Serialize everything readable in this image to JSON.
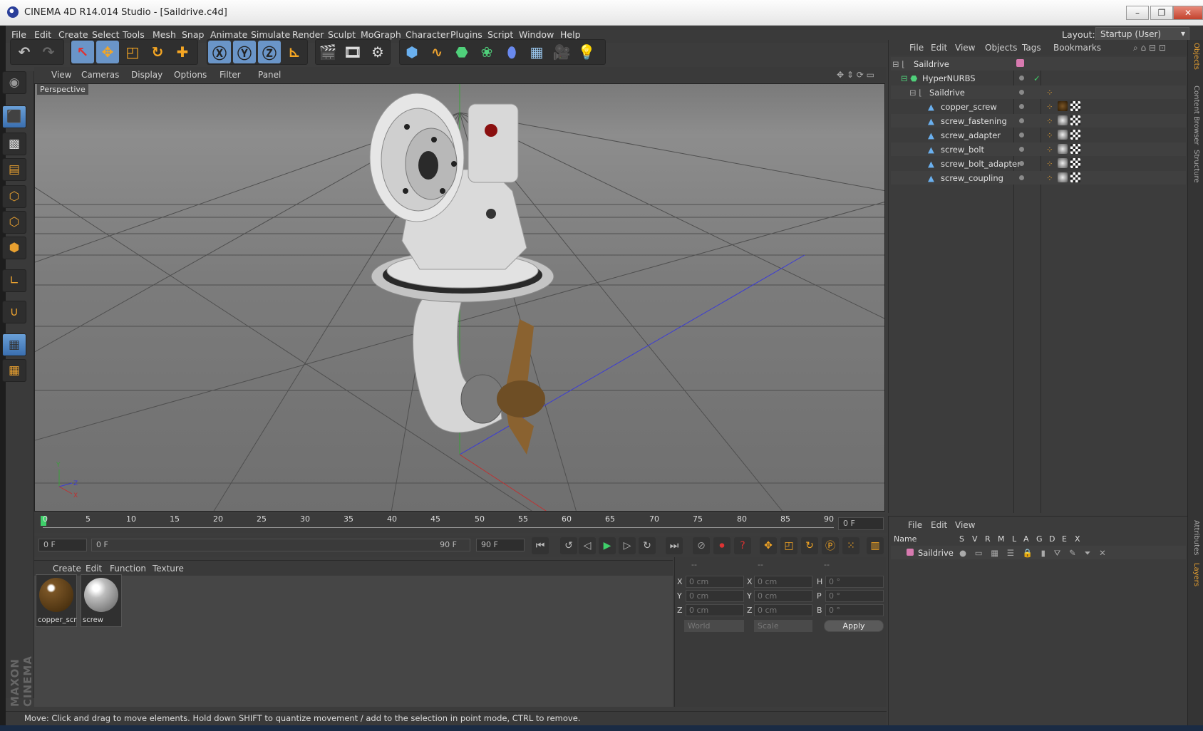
{
  "window": {
    "title": "CINEMA 4D R14.014 Studio - [Saildrive.c4d]",
    "minimize": "–",
    "maximize": "❐",
    "close": "✕"
  },
  "menu": {
    "items": [
      "File",
      "Edit",
      "Create",
      "Select",
      "Tools",
      "Mesh",
      "Snap",
      "Animate",
      "Simulate",
      "Render",
      "Sculpt",
      "MoGraph",
      "Character",
      "Plugins",
      "Script",
      "Window",
      "Help"
    ],
    "layout_label": "Layout:",
    "layout_value": "Startup (User)"
  },
  "viewport": {
    "menu": [
      "View",
      "Cameras",
      "Display",
      "Options",
      "Filter",
      "Panel"
    ],
    "label": "Perspective",
    "axis_y": "Y",
    "axis_z": "Z",
    "axis_x": "X"
  },
  "timeline": {
    "ticks": [
      "0",
      "5",
      "10",
      "15",
      "20",
      "25",
      "30",
      "35",
      "40",
      "45",
      "50",
      "55",
      "60",
      "65",
      "70",
      "75",
      "80",
      "85",
      "90"
    ],
    "current_frame": "0 F",
    "start_field": "0 F",
    "range_start": "0 F",
    "range_end": "90 F",
    "end_field": "90 F"
  },
  "materials": {
    "menu": [
      "Create",
      "Edit",
      "Function",
      "Texture"
    ],
    "items": [
      {
        "label": "copper_scr"
      },
      {
        "label": "screw"
      }
    ]
  },
  "coordinates": {
    "headers": [
      "--",
      "--",
      "--"
    ],
    "rows": [
      {
        "l1": "X",
        "v1": "0 cm",
        "l2": "X",
        "v2": "0 cm",
        "l3": "H",
        "v3": "0 °"
      },
      {
        "l1": "Y",
        "v1": "0 cm",
        "l2": "Y",
        "v2": "0 cm",
        "l3": "P",
        "v3": "0 °"
      },
      {
        "l1": "Z",
        "v1": "0 cm",
        "l2": "Z",
        "v2": "0 cm",
        "l3": "B",
        "v3": "0 °"
      }
    ],
    "space": "World",
    "mode": "Scale",
    "apply": "Apply"
  },
  "objects": {
    "menu": [
      "File",
      "Edit",
      "View",
      "Objects",
      "Tags",
      "Bookmarks"
    ],
    "items": [
      "Saildrive",
      "HyperNURBS",
      "Saildrive",
      "copper_screw",
      "screw_fastening",
      "screw_adapter",
      "screw_bolt",
      "screw_bolt_adapter",
      "screw_coupling"
    ]
  },
  "layers": {
    "menu": [
      "File",
      "Edit",
      "View"
    ],
    "columns": [
      "Name",
      "S",
      "V",
      "R",
      "M",
      "L",
      "A",
      "G",
      "D",
      "E",
      "X"
    ],
    "items": [
      {
        "name": "Saildrive"
      }
    ]
  },
  "side_tabs": [
    "Objects",
    "Content Browser",
    "Structure",
    "Attributes",
    "Layers"
  ],
  "brand": "MAXON CINEMA 4D",
  "status": "Move: Click and drag to move elements. Hold down SHIFT to quantize movement / add to the selection in point mode, CTRL to remove."
}
